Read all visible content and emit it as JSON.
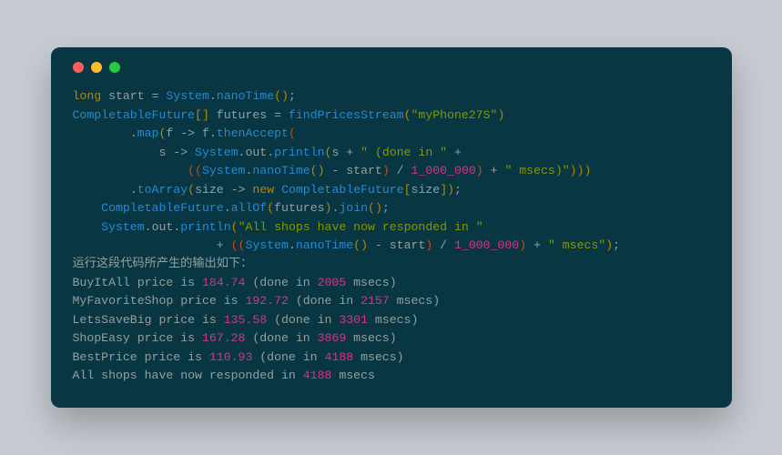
{
  "code_tokens": [
    [
      {
        "cls": "kw",
        "t": "long"
      },
      {
        "cls": "id",
        "t": " start "
      },
      {
        "cls": "op",
        "t": "="
      },
      {
        "cls": "id",
        "t": " "
      },
      {
        "cls": "ty",
        "t": "System"
      },
      {
        "cls": "op",
        "t": "."
      },
      {
        "cls": "fn",
        "t": "nanoTime"
      },
      {
        "cls": "par",
        "t": "("
      },
      {
        "cls": "par",
        "t": ")"
      },
      {
        "cls": "op",
        "t": ";"
      }
    ],
    [
      {
        "cls": "ty",
        "t": "CompletableFuture"
      },
      {
        "cls": "par",
        "t": "[]"
      },
      {
        "cls": "id",
        "t": " futures "
      },
      {
        "cls": "op",
        "t": "="
      },
      {
        "cls": "id",
        "t": " "
      },
      {
        "cls": "fn",
        "t": "findPricesStream"
      },
      {
        "cls": "par",
        "t": "("
      },
      {
        "cls": "str",
        "t": "\"myPhone27S\""
      },
      {
        "cls": "par",
        "t": ")"
      }
    ],
    [
      {
        "cls": "id",
        "t": "        "
      },
      {
        "cls": "op",
        "t": "."
      },
      {
        "cls": "fn",
        "t": "map"
      },
      {
        "cls": "par",
        "t": "("
      },
      {
        "cls": "id",
        "t": "f "
      },
      {
        "cls": "op",
        "t": "->"
      },
      {
        "cls": "id",
        "t": " f"
      },
      {
        "cls": "op",
        "t": "."
      },
      {
        "cls": "fn",
        "t": "thenAccept"
      },
      {
        "cls": "par2",
        "t": "("
      }
    ],
    [
      {
        "cls": "id",
        "t": "            s "
      },
      {
        "cls": "op",
        "t": "->"
      },
      {
        "cls": "id",
        "t": " "
      },
      {
        "cls": "ty",
        "t": "System"
      },
      {
        "cls": "op",
        "t": "."
      },
      {
        "cls": "id",
        "t": "out"
      },
      {
        "cls": "op",
        "t": "."
      },
      {
        "cls": "fn",
        "t": "println"
      },
      {
        "cls": "par",
        "t": "("
      },
      {
        "cls": "id",
        "t": "s "
      },
      {
        "cls": "op",
        "t": "+"
      },
      {
        "cls": "id",
        "t": " "
      },
      {
        "cls": "str",
        "t": "\" (done in \""
      },
      {
        "cls": "id",
        "t": " "
      },
      {
        "cls": "op",
        "t": "+"
      }
    ],
    [
      {
        "cls": "id",
        "t": "                "
      },
      {
        "cls": "par2",
        "t": "(("
      },
      {
        "cls": "ty",
        "t": "System"
      },
      {
        "cls": "op",
        "t": "."
      },
      {
        "cls": "fn",
        "t": "nanoTime"
      },
      {
        "cls": "par",
        "t": "()"
      },
      {
        "cls": "id",
        "t": " "
      },
      {
        "cls": "op",
        "t": "-"
      },
      {
        "cls": "id",
        "t": " start"
      },
      {
        "cls": "par2",
        "t": ")"
      },
      {
        "cls": "id",
        "t": " "
      },
      {
        "cls": "op",
        "t": "/"
      },
      {
        "cls": "id",
        "t": " "
      },
      {
        "cls": "num",
        "t": "1_000_000"
      },
      {
        "cls": "par2",
        "t": ")"
      },
      {
        "cls": "id",
        "t": " "
      },
      {
        "cls": "op",
        "t": "+"
      },
      {
        "cls": "id",
        "t": " "
      },
      {
        "cls": "str",
        "t": "\" msecs)\""
      },
      {
        "cls": "par",
        "t": ")))"
      }
    ],
    [
      {
        "cls": "id",
        "t": "        "
      },
      {
        "cls": "op",
        "t": "."
      },
      {
        "cls": "fn",
        "t": "toArray"
      },
      {
        "cls": "par",
        "t": "("
      },
      {
        "cls": "id",
        "t": "size "
      },
      {
        "cls": "op",
        "t": "->"
      },
      {
        "cls": "id",
        "t": " "
      },
      {
        "cls": "kw",
        "t": "new"
      },
      {
        "cls": "id",
        "t": " "
      },
      {
        "cls": "ty",
        "t": "CompletableFuture"
      },
      {
        "cls": "par",
        "t": "["
      },
      {
        "cls": "id",
        "t": "size"
      },
      {
        "cls": "par",
        "t": "])"
      },
      {
        "cls": "op",
        "t": ";"
      }
    ],
    [
      {
        "cls": "id",
        "t": "    "
      },
      {
        "cls": "ty",
        "t": "CompletableFuture"
      },
      {
        "cls": "op",
        "t": "."
      },
      {
        "cls": "fn",
        "t": "allOf"
      },
      {
        "cls": "par",
        "t": "("
      },
      {
        "cls": "id",
        "t": "futures"
      },
      {
        "cls": "par",
        "t": ")"
      },
      {
        "cls": "op",
        "t": "."
      },
      {
        "cls": "fn",
        "t": "join"
      },
      {
        "cls": "par",
        "t": "()"
      },
      {
        "cls": "op",
        "t": ";"
      }
    ],
    [
      {
        "cls": "id",
        "t": "    "
      },
      {
        "cls": "ty",
        "t": "System"
      },
      {
        "cls": "op",
        "t": "."
      },
      {
        "cls": "id",
        "t": "out"
      },
      {
        "cls": "op",
        "t": "."
      },
      {
        "cls": "fn",
        "t": "println"
      },
      {
        "cls": "par",
        "t": "("
      },
      {
        "cls": "str",
        "t": "\"All shops have now responded in \""
      }
    ],
    [
      {
        "cls": "id",
        "t": "                    "
      },
      {
        "cls": "op",
        "t": "+"
      },
      {
        "cls": "id",
        "t": " "
      },
      {
        "cls": "par2",
        "t": "(("
      },
      {
        "cls": "ty",
        "t": "System"
      },
      {
        "cls": "op",
        "t": "."
      },
      {
        "cls": "fn",
        "t": "nanoTime"
      },
      {
        "cls": "par",
        "t": "()"
      },
      {
        "cls": "id",
        "t": " "
      },
      {
        "cls": "op",
        "t": "-"
      },
      {
        "cls": "id",
        "t": " start"
      },
      {
        "cls": "par2",
        "t": ")"
      },
      {
        "cls": "id",
        "t": " "
      },
      {
        "cls": "op",
        "t": "/"
      },
      {
        "cls": "id",
        "t": " "
      },
      {
        "cls": "num",
        "t": "1_000_000"
      },
      {
        "cls": "par2",
        "t": ")"
      },
      {
        "cls": "id",
        "t": " "
      },
      {
        "cls": "op",
        "t": "+"
      },
      {
        "cls": "id",
        "t": " "
      },
      {
        "cls": "str",
        "t": "\" msecs\""
      },
      {
        "cls": "par",
        "t": ")"
      },
      {
        "cls": "op",
        "t": ";"
      }
    ]
  ],
  "output_label": "运行这段代码所产生的输出如下：",
  "output_lines": [
    {
      "shop": "BuyItAll",
      "price": "184.74",
      "ms": "2005"
    },
    {
      "shop": "MyFavoriteShop",
      "price": "192.72",
      "ms": "2157"
    },
    {
      "shop": "LetsSaveBig",
      "price": "135.58",
      "ms": "3301"
    },
    {
      "shop": "ShopEasy",
      "price": "167.28",
      "ms": "3869"
    },
    {
      "shop": "BestPrice",
      "price": "110.93",
      "ms": "4188"
    }
  ],
  "final_line_prefix": "All shops have now responded in ",
  "final_line_ms": "4188",
  "final_line_suffix": " msecs"
}
